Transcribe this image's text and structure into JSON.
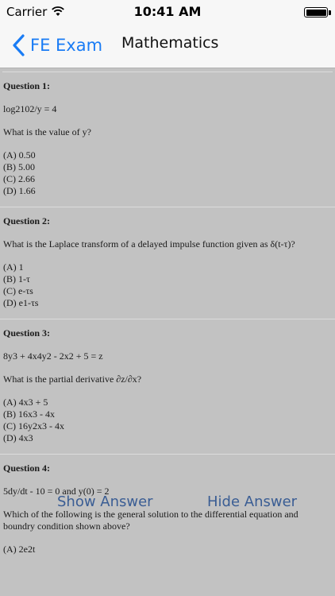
{
  "status_bar": {
    "carrier": "Carrier",
    "time": "10:41 AM"
  },
  "nav": {
    "back_label": "FE Exam",
    "title": "Mathematics"
  },
  "questions": [
    {
      "title": "Question 1:",
      "lines": [
        "log2102/y = 4",
        "What is the value of y?"
      ],
      "options": [
        "(A) 0.50",
        "(B) 5.00",
        "(C) 2.66",
        "(D) 1.66"
      ]
    },
    {
      "title": "Question 2:",
      "lines": [
        "What is the Laplace transform of a delayed impulse function given as δ(t-τ)?"
      ],
      "options": [
        "(A) 1",
        "(B) 1-τ",
        "(C) e-τs",
        "(D) e1-τs"
      ]
    },
    {
      "title": "Question 3:",
      "lines": [
        "8y3 + 4x4y2 - 2x2 + 5 = z",
        "What is the partial derivative ∂z/∂x?"
      ],
      "options": [
        "(A) 4x3 + 5",
        "(B) 16x3 - 4x",
        "(C) 16y2x3 - 4x",
        "(D) 4x3"
      ]
    },
    {
      "title": "Question 4:",
      "lines": [
        "5dy/dt - 10 = 0 and y(0) = 2",
        "Which of the following is the general solution to the differential equation and boundry condition shown above?"
      ],
      "options": [
        "(A) 2e2t"
      ]
    }
  ],
  "answer_bar": {
    "show_label": "Show Answer",
    "hide_label": "Hide Answer"
  },
  "colors": {
    "accent": "#1a7cf5",
    "answer_button": "#3a5d94",
    "background": "#c2c2c2"
  }
}
